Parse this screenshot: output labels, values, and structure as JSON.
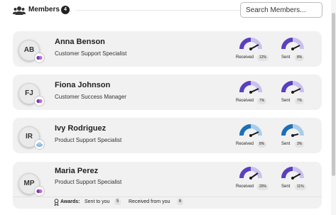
{
  "header": {
    "title": "Members",
    "count": "4",
    "search_placeholder": "Search Members..."
  },
  "colors": {
    "received_fill": "#5a3fc0",
    "received_track": "#c9c0ef",
    "blue_fill": "#1e6fb5",
    "blue_track": "#a9cde9",
    "needle": "#1a1a1a"
  },
  "gauge_labels": {
    "received": "Received",
    "sent": "Sent"
  },
  "members": [
    {
      "initials": "AB",
      "name": "Anna Benson",
      "role": "Customer Support Specialist",
      "received_pct": "12%",
      "received_fraction": 0.12,
      "sent_pct": "8%",
      "sent_fraction": 0.08,
      "theme": "purple",
      "badge": "purple"
    },
    {
      "initials": "FJ",
      "name": "Fiona Johnson",
      "role": "Customer Success Manager",
      "received_pct": "7%",
      "received_fraction": 0.07,
      "sent_pct": "7%",
      "sent_fraction": 0.07,
      "theme": "purple",
      "badge": "purple"
    },
    {
      "initials": "IR",
      "name": "Ivy Rodriguez",
      "role": "Product Support Specialist",
      "received_pct": "8%",
      "received_fraction": 0.08,
      "sent_pct": "3%",
      "sent_fraction": 0.03,
      "theme": "blue",
      "badge": "blue"
    },
    {
      "initials": "MP",
      "name": "Maria Perez",
      "role": "Product Support Specialist",
      "received_pct": "20%",
      "received_fraction": 0.2,
      "sent_pct": "11%",
      "sent_fraction": 0.11,
      "theme": "purple",
      "badge": "purple"
    }
  ],
  "awards": {
    "label": "Awards:",
    "sent_label": "Sent to you",
    "sent_count": "5",
    "received_label": "Received from you",
    "received_count": "6"
  }
}
